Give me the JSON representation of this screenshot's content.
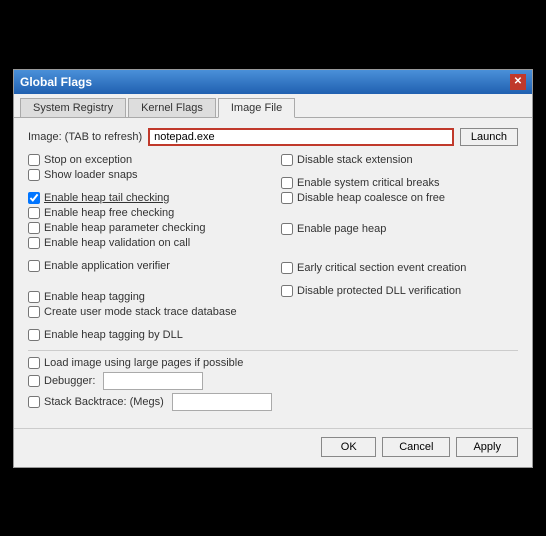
{
  "window": {
    "title": "Global Flags",
    "close_label": "✕"
  },
  "tabs": [
    {
      "label": "System Registry",
      "active": false
    },
    {
      "label": "Kernel Flags",
      "active": false
    },
    {
      "label": "Image File",
      "active": true
    }
  ],
  "image_section": {
    "label": "Image: (TAB to refresh)",
    "value": "notepad.exe",
    "launch_label": "Launch"
  },
  "left_col": {
    "checkboxes": [
      {
        "label": "Stop on exception",
        "checked": false
      },
      {
        "label": "Show loader snaps",
        "checked": false
      }
    ],
    "heap_checkboxes": [
      {
        "label": "Enable heap tail checking",
        "checked": true,
        "underline": true
      },
      {
        "label": "Enable heap free checking",
        "checked": false
      },
      {
        "label": "Enable heap parameter checking",
        "checked": false
      },
      {
        "label": "Enable heap validation on call",
        "checked": false
      }
    ],
    "app_verifier": {
      "label": "Enable application verifier",
      "checked": false
    },
    "tagging": [
      {
        "label": "Enable heap tagging",
        "checked": false
      },
      {
        "label": "Create user mode stack trace database",
        "checked": false
      }
    ],
    "dll_tagging": {
      "label": "Enable heap tagging by DLL",
      "checked": false
    }
  },
  "right_col": {
    "top_checkboxes": [
      {
        "label": "Disable stack extension",
        "checked": false
      }
    ],
    "break_checkboxes": [
      {
        "label": "Enable system critical breaks",
        "checked": false
      },
      {
        "label": "Disable heap coalesce on free",
        "checked": false
      }
    ],
    "page_heap": {
      "label": "Enable page heap",
      "checked": false
    },
    "early_critical": {
      "label": "Early critical section event creation",
      "checked": false
    },
    "protected_dll": {
      "label": "Disable protected DLL verification",
      "checked": false
    }
  },
  "bottom_section": {
    "large_pages": {
      "label": "Load image using large pages if possible",
      "checked": false
    },
    "debugger": {
      "label": "Debugger:",
      "checked": false,
      "value": ""
    },
    "stack_backtrace": {
      "label": "Stack Backtrace: (Megs)",
      "checked": false,
      "value": ""
    }
  },
  "footer": {
    "ok_label": "OK",
    "cancel_label": "Cancel",
    "apply_label": "Apply"
  }
}
